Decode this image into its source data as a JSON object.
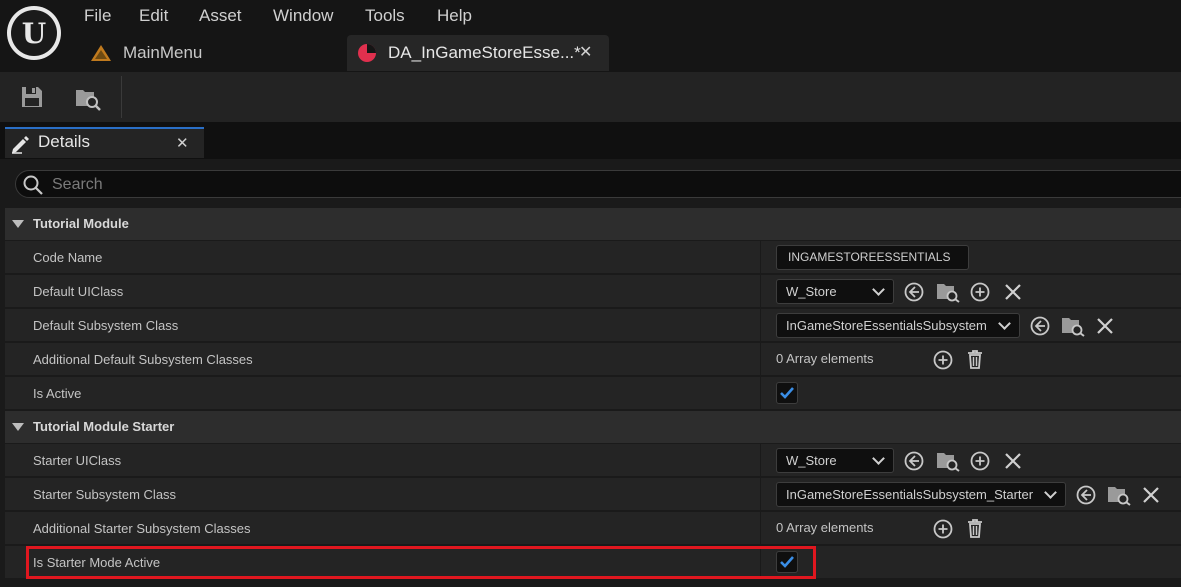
{
  "app": {
    "logo_letter": "U",
    "menu": [
      "File",
      "Edit",
      "Asset",
      "Window",
      "Tools",
      "Help"
    ]
  },
  "tabs": [
    {
      "label": "MainMenu"
    },
    {
      "label": "DA_InGameStoreEsse...*"
    }
  ],
  "details": {
    "tab_label": "Details",
    "search_placeholder": "Search"
  },
  "categories": [
    {
      "label": "Tutorial Module",
      "rows": [
        {
          "name": "Code Name",
          "value": "INGAMESTOREESSENTIALS"
        },
        {
          "name": "Default UIClass",
          "value": "W_Store"
        },
        {
          "name": "Default Subsystem Class",
          "value": "InGameStoreEssentialsSubsystem"
        },
        {
          "name": "Additional Default Subsystem Classes",
          "value": "0 Array elements"
        },
        {
          "name": "Is Active",
          "checked": true
        }
      ]
    },
    {
      "label": "Tutorial Module Starter",
      "rows": [
        {
          "name": "Starter UIClass",
          "value": "W_Store"
        },
        {
          "name": "Starter Subsystem Class",
          "value": "InGameStoreEssentialsSubsystem_Starter"
        },
        {
          "name": "Additional Starter Subsystem Classes",
          "value": "0 Array elements"
        },
        {
          "name": "Is Starter Mode Active",
          "checked": true
        }
      ]
    }
  ],
  "colors": {
    "accent": "#2a6fc7",
    "checkmark": "#3a8ee6",
    "highlight": "#e0171f",
    "tab_icon": "#e0304e"
  }
}
